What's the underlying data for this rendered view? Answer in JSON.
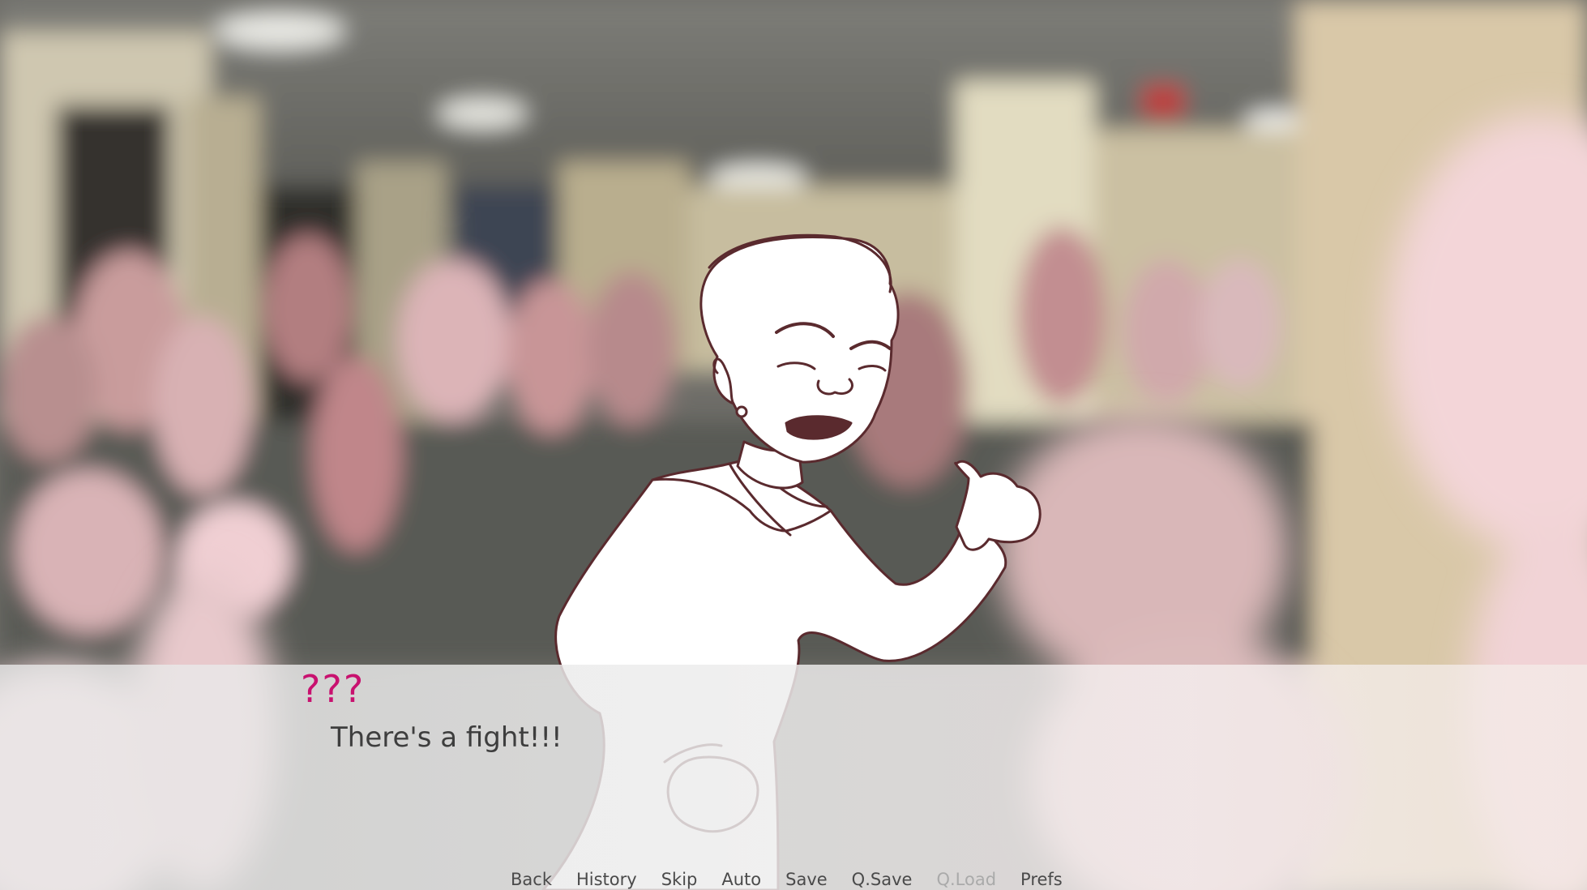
{
  "dialogue": {
    "speaker": "???",
    "text": "There's a fight!!!"
  },
  "quick_menu": [
    {
      "label": "Back",
      "enabled": true
    },
    {
      "label": "History",
      "enabled": true
    },
    {
      "label": "Skip",
      "enabled": true
    },
    {
      "label": "Auto",
      "enabled": true
    },
    {
      "label": "Save",
      "enabled": true
    },
    {
      "label": "Q.Save",
      "enabled": true
    },
    {
      "label": "Q.Load",
      "enabled": false
    },
    {
      "label": "Prefs",
      "enabled": true
    }
  ],
  "colors": {
    "speaker_name": "#c8116f",
    "dialogue_text": "#3e3e3e",
    "menu_text": "#4a4a4a",
    "menu_disabled": "#aaaaaa",
    "character_outline": "#5a2a2e"
  },
  "scene": {
    "background": "blurred-school-hallway-with-crowd",
    "character_sprite": "student-in-sailor-uniform-pointing-thumb"
  }
}
